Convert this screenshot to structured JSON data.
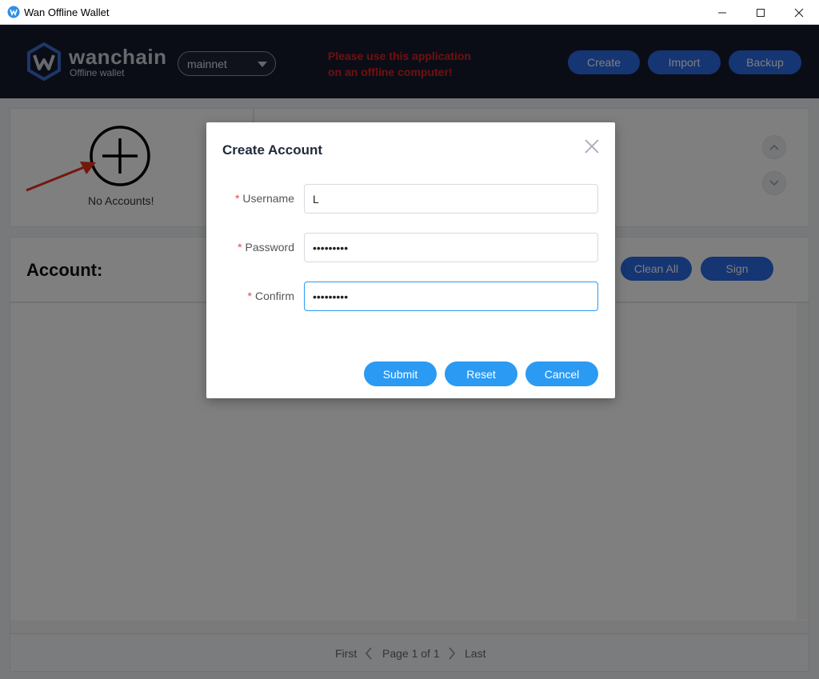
{
  "window": {
    "title": "Wan Offline Wallet"
  },
  "header": {
    "brand": "wanchain",
    "brand_sub": "Offline wallet",
    "network": "mainnet",
    "warning_line1": "Please use this application",
    "warning_line2": "on an offline computer!",
    "buttons": {
      "create": "Create",
      "import": "Import",
      "backup": "Backup"
    }
  },
  "accounts": {
    "empty_text": "No Accounts!"
  },
  "account_panel": {
    "title": "Account:",
    "clean_all": "Clean All",
    "sign": "Sign"
  },
  "pagination": {
    "first": "First",
    "page": "Page 1 of 1",
    "last": "Last"
  },
  "modal": {
    "title": "Create Account",
    "username_label": "Username",
    "username_value": "L",
    "password_label": "Password",
    "password_value": "123456789",
    "confirm_label": "Confirm",
    "confirm_value": "123456789",
    "submit": "Submit",
    "reset": "Reset",
    "cancel": "Cancel"
  },
  "colors": {
    "header_bg": "#161b2c",
    "primary_button": "#2b6ae6",
    "modal_button": "#2b9af3",
    "warning": "#e02020"
  },
  "icons": [
    "wanchain-app-icon",
    "wanchain-logo-icon",
    "minimize-icon",
    "maximize-icon",
    "close-icon",
    "chevron-down-icon",
    "plus-circle-icon",
    "red-arrow-icon",
    "scroll-up-icon",
    "scroll-down-icon",
    "chevron-left-icon",
    "chevron-right-icon",
    "modal-close-icon"
  ]
}
